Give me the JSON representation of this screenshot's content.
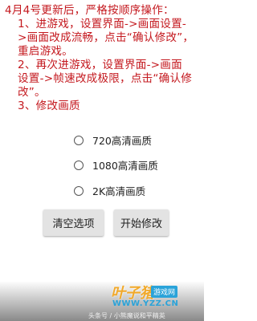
{
  "instructions": {
    "line1": "4月4号更新后，严格按顺序操作：",
    "line2": "1、进游戏，设置界面->画面设置-",
    "line3": ">画面改成流畅，点击“确认修改”，",
    "line4": "重启游戏。",
    "line5": "2、再次进游戏，设置界面->画面",
    "line6": "设置->帧速改成极限，点击“确认修",
    "line7": "改”。",
    "line8": "3、修改画质"
  },
  "options": [
    {
      "label": "720高清画质",
      "selected": false
    },
    {
      "label": "1080高清画质",
      "selected": false
    },
    {
      "label": "2K高清画质",
      "selected": false
    }
  ],
  "buttons": {
    "clear": "清空选项",
    "start": "开始修改"
  },
  "watermark": {
    "logo": "叶子猪",
    "site": "游戏网",
    "url": "WWW.YZZ.CN",
    "credit": "头条号 / 小熊魔说和平精英"
  },
  "colors": {
    "instruction_text": "#c4191f",
    "button_bg": "#e3e3e3"
  }
}
